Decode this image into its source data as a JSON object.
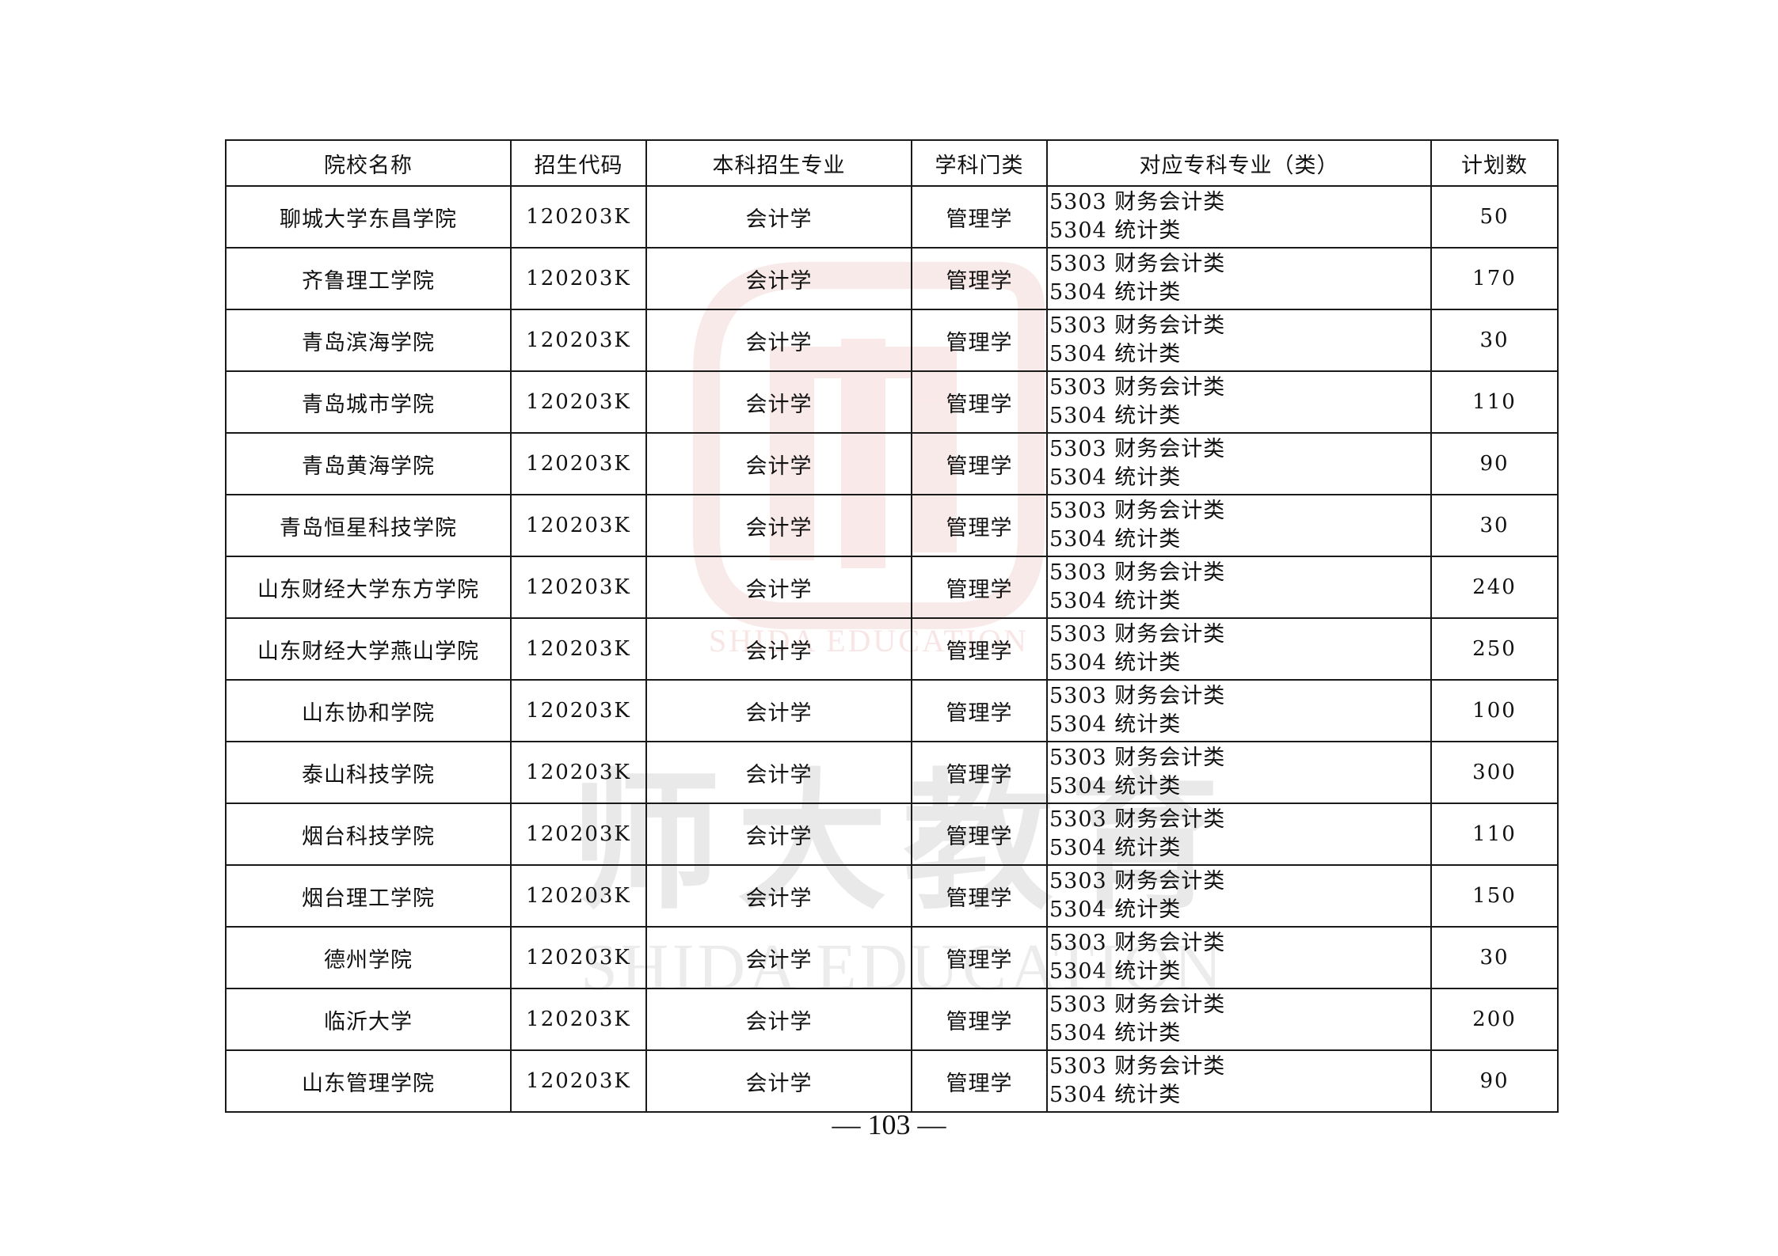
{
  "table": {
    "headers": [
      "院校名称",
      "招生代码",
      "本科招生专业",
      "学科门类",
      "对应专科专业（类）",
      "计划数"
    ],
    "rows": [
      {
        "school": "聊城大学东昌学院",
        "code": "120203K",
        "major": "会计学",
        "category": "管理学",
        "related": [
          "5303 财务会计类",
          "5304 统计类"
        ],
        "plan": "50"
      },
      {
        "school": "齐鲁理工学院",
        "code": "120203K",
        "major": "会计学",
        "category": "管理学",
        "related": [
          "5303 财务会计类",
          "5304 统计类"
        ],
        "plan": "170"
      },
      {
        "school": "青岛滨海学院",
        "code": "120203K",
        "major": "会计学",
        "category": "管理学",
        "related": [
          "5303 财务会计类",
          "5304 统计类"
        ],
        "plan": "30"
      },
      {
        "school": "青岛城市学院",
        "code": "120203K",
        "major": "会计学",
        "category": "管理学",
        "related": [
          "5303 财务会计类",
          "5304 统计类"
        ],
        "plan": "110"
      },
      {
        "school": "青岛黄海学院",
        "code": "120203K",
        "major": "会计学",
        "category": "管理学",
        "related": [
          "5303 财务会计类",
          "5304 统计类"
        ],
        "plan": "90"
      },
      {
        "school": "青岛恒星科技学院",
        "code": "120203K",
        "major": "会计学",
        "category": "管理学",
        "related": [
          "5303 财务会计类",
          "5304 统计类"
        ],
        "plan": "30"
      },
      {
        "school": "山东财经大学东方学院",
        "code": "120203K",
        "major": "会计学",
        "category": "管理学",
        "related": [
          "5303 财务会计类",
          "5304 统计类"
        ],
        "plan": "240"
      },
      {
        "school": "山东财经大学燕山学院",
        "code": "120203K",
        "major": "会计学",
        "category": "管理学",
        "related": [
          "5303 财务会计类",
          "5304 统计类"
        ],
        "plan": "250"
      },
      {
        "school": "山东协和学院",
        "code": "120203K",
        "major": "会计学",
        "category": "管理学",
        "related": [
          "5303 财务会计类",
          "5304 统计类"
        ],
        "plan": "100"
      },
      {
        "school": "泰山科技学院",
        "code": "120203K",
        "major": "会计学",
        "category": "管理学",
        "related": [
          "5303 财务会计类",
          "5304 统计类"
        ],
        "plan": "300"
      },
      {
        "school": "烟台科技学院",
        "code": "120203K",
        "major": "会计学",
        "category": "管理学",
        "related": [
          "5303 财务会计类",
          "5304 统计类"
        ],
        "plan": "110"
      },
      {
        "school": "烟台理工学院",
        "code": "120203K",
        "major": "会计学",
        "category": "管理学",
        "related": [
          "5303 财务会计类",
          "5304 统计类"
        ],
        "plan": "150"
      },
      {
        "school": "德州学院",
        "code": "120203K",
        "major": "会计学",
        "category": "管理学",
        "related": [
          "5303 财务会计类",
          "5304 统计类"
        ],
        "plan": "30"
      },
      {
        "school": "临沂大学",
        "code": "120203K",
        "major": "会计学",
        "category": "管理学",
        "related": [
          "5303 财务会计类",
          "5304 统计类"
        ],
        "plan": "200"
      },
      {
        "school": "山东管理学院",
        "code": "120203K",
        "major": "会计学",
        "category": "管理学",
        "related": [
          "5303 财务会计类",
          "5304 统计类"
        ],
        "plan": "90"
      }
    ]
  },
  "page_number": "— 103 —",
  "watermark": {
    "logo_text": "SHIDA EDUCATION",
    "brand_text": "师大教育",
    "brand_subtext": "SHIDA EDUCATION",
    "logo_color": "#c8322f",
    "text_color": "#e9e9e9"
  }
}
